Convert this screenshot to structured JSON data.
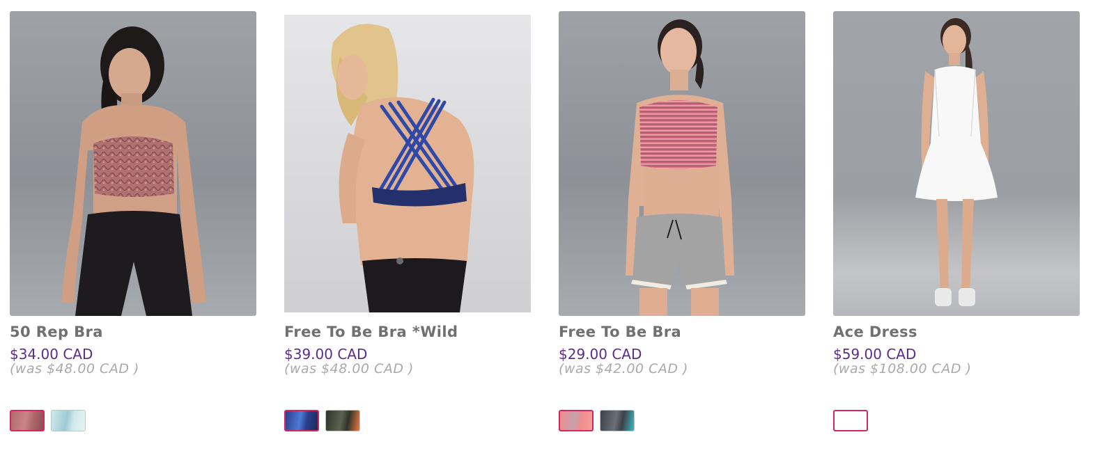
{
  "products": [
    {
      "name": "50 Rep Bra",
      "price": "$34.00 CAD",
      "was_price": "(was $48.00 CAD )",
      "image_alt": "model wearing a snakeskin print sports bra and black tights",
      "swatches": [
        {
          "selected": true,
          "colors": [
            "#b06a6e",
            "#c98588",
            "#8e4d55"
          ]
        },
        {
          "selected": false,
          "colors": [
            "#cfe9ec",
            "#9ec9d2",
            "#e7f3f2"
          ]
        }
      ]
    },
    {
      "name": "Free To Be Bra *Wild",
      "price": "$39.00 CAD",
      "was_price": "(was $48.00 CAD )",
      "image_alt": "back view of model wearing a blue strappy sports bra",
      "swatches": [
        {
          "selected": true,
          "colors": [
            "#2c3f8c",
            "#4d7ad6",
            "#1d2a5a"
          ]
        },
        {
          "selected": false,
          "colors": [
            "#2e332a",
            "#5d6350",
            "#f2793e"
          ]
        }
      ]
    },
    {
      "name": "Free To Be Bra",
      "price": "$29.00 CAD",
      "was_price": "(was $42.00 CAD )",
      "image_alt": "model wearing a pink striped sports bra and grey shorts",
      "swatches": [
        {
          "selected": true,
          "colors": [
            "#f08d8d",
            "#c5a1ad",
            "#f7a09a"
          ]
        },
        {
          "selected": false,
          "colors": [
            "#3c4148",
            "#6a7078",
            "#3cb9c4"
          ]
        }
      ]
    },
    {
      "name": "Ace Dress",
      "price": "$59.00 CAD",
      "was_price": "(was $108.00 CAD )",
      "image_alt": "model wearing a white tennis dress",
      "swatches": [
        {
          "selected": true,
          "colors": [
            "#ffffff",
            "#ffffff",
            "#ffffff"
          ]
        }
      ]
    }
  ]
}
